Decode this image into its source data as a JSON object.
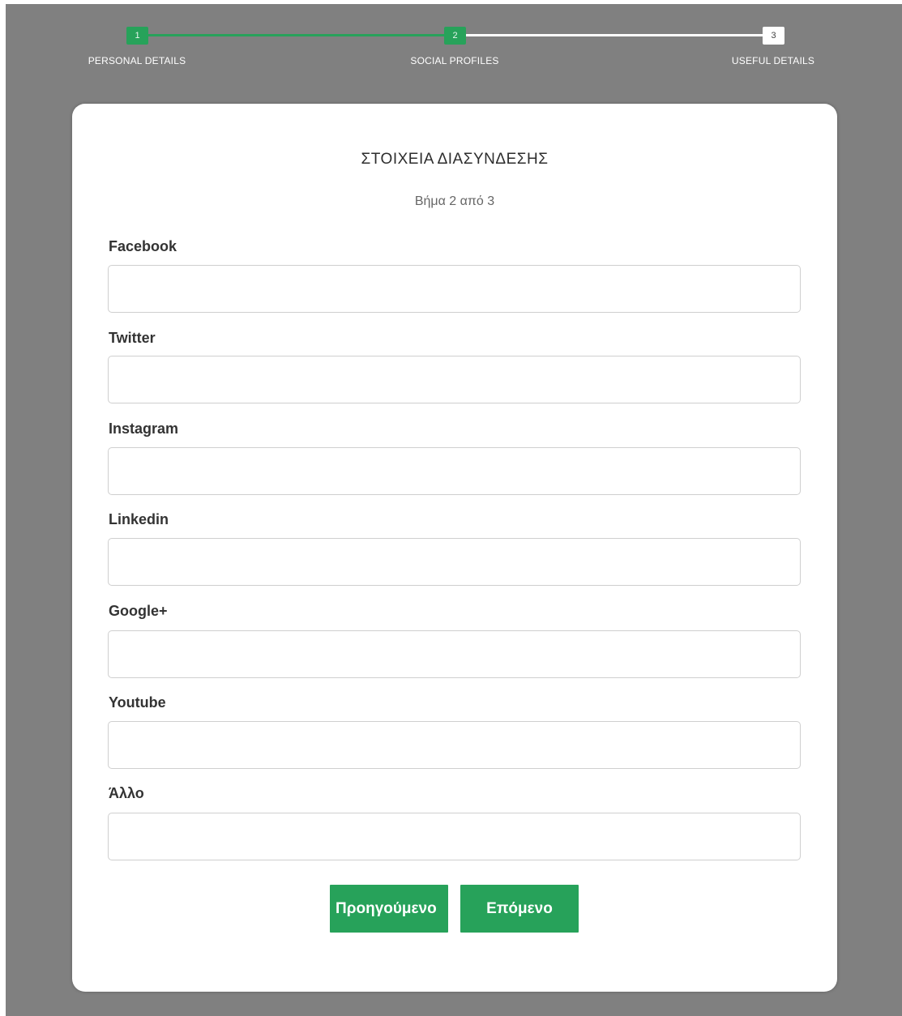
{
  "progress": {
    "steps": [
      {
        "number": "1",
        "label": "PERSONAL DETAILS",
        "state": "done"
      },
      {
        "number": "2",
        "label": "SOCIAL PROFILES",
        "state": "current"
      },
      {
        "number": "3",
        "label": "USEFUL DETAILS",
        "state": "todo"
      }
    ],
    "completed_fraction": 0.5
  },
  "form": {
    "title": "ΣΤΟΙΧΕΙΑ ΔΙΑΣΥΝΔΕΣΗΣ",
    "subtitle": "Βήμα 2 από 3",
    "fields": [
      {
        "label": "Facebook",
        "value": ""
      },
      {
        "label": "Twitter",
        "value": ""
      },
      {
        "label": "Instagram",
        "value": ""
      },
      {
        "label": "Linkedin",
        "value": ""
      },
      {
        "label": "Google+",
        "value": ""
      },
      {
        "label": "Youtube",
        "value": ""
      },
      {
        "label": "Άλλο",
        "value": ""
      }
    ],
    "prev_label": "Προηγούμενο",
    "next_label": "Επόμενο"
  },
  "colors": {
    "accent": "#27a25a",
    "background": "#808080",
    "card": "#ffffff"
  }
}
